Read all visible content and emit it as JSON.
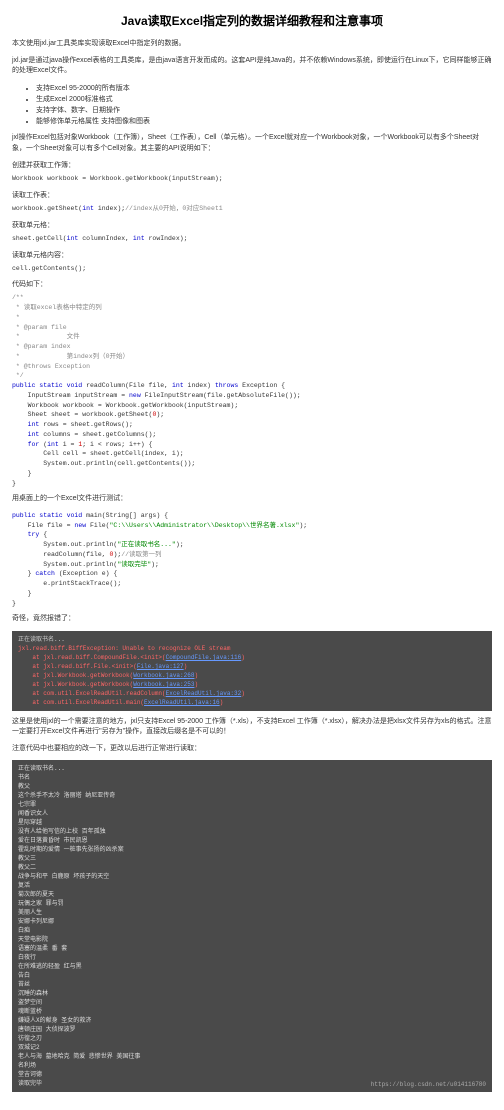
{
  "title": "Java读取Excel指定列的数据详细教程和注意事项",
  "intro1": "本文使用jxl.jar工具类库实现读取Excel中指定列的数据。",
  "intro2": "jxl.jar是通过java操作excel表格的工具类库，是由java语言开发而成的。这套API是纯Java的，并不依赖Windows系统，即使运行在Linux下，它同样能够正确的处理Excel文件。",
  "features": [
    "支持Excel 95-2000的所有版本",
    "生成Excel 2000标准格式",
    "支持字体、数字、日期操作",
    "能够修饰单元格属性 支持图像和图表"
  ],
  "objdesc": "jxl操作Excel包括对象Workbook（工作簿），Sheet（工作表），Cell（单元格）。一个Excel就对应一个Workbook对象，一个Workbook可以有多个Sheet对象，一个Sheet对象可以有多个Cell对象。其主要的API说明如下：",
  "steps": {
    "s1": "创建并获取工作簿：",
    "s1code": "Workbook workbook = Workbook.getWorkbook(inputStream);",
    "s2": "读取工作表：",
    "s2code_a": "workbook.getSheet(",
    "s2code_b": " index);",
    "s2cmt": "//index从0开始，0对应Sheet1",
    "s3": "获取单元格：",
    "s3code_a": "sheet.getCell(",
    "s3code_b": " columnIndex, ",
    "s3code_c": " rowIndex);",
    "s4": "读取单元格内容：",
    "s4code": "cell.getContents();",
    "s5": "代码如下："
  },
  "codedoc": {
    "c1": "/**",
    "c2": " * 读取excel表格中特定的列",
    "c3": " *",
    "c4": " * @param file",
    "c5": " *            文件",
    "c6": " * @param index",
    "c7": " *            第index列（0开始）",
    "c8": " * @throws Exception",
    "c9": " */",
    "l1a": "public static void",
    "l1b": " readColumn(File file, ",
    "l1c": " index) ",
    "l1d": "throws",
    "l1e": " Exception {",
    "l2": "    InputStream inputStream = ",
    "l2b": " FileInputStream(file.getAbsoluteFile());",
    "l3": "    Workbook workbook = Workbook.getWorkbook(inputStream);",
    "l4": "    Sheet sheet = workbook.getSheet(",
    "l4b": ");",
    "l5": "    ",
    "l5b": " rows = sheet.getRows();",
    "l6": "    ",
    "l6b": " columns = sheet.getColumns();",
    "l7": "    ",
    "l7b": " (",
    "l7c": " i = ",
    "l7d": "; i < rows; i++) {",
    "l8": "        Cell cell = sheet.getCell(index, i);",
    "l9": "        System.out.println(cell.getContents());",
    "l10": "    }",
    "l11": "}"
  },
  "mid1": "用桌面上的一个Excel文件进行测试：",
  "main": {
    "l1a": "public static void",
    "l1b": " main(String[] args) {",
    "l2": "    File file = ",
    "l2b": " File(",
    "l2str": "\"C:\\\\Users\\\\Administrator\\\\Desktop\\\\世界名著.xlsx\"",
    "l2c": ");",
    "l3": "    ",
    "l3b": " {",
    "l4": "        System.out.println(",
    "l4str": "\"正在读取书名...\"",
    "l4b": ");",
    "l5": "        readColumn(file, ",
    "l5b": ");",
    "l5cmt": "//读取第一列",
    "l6": "        System.out.println(",
    "l6str": "\"读取完毕\"",
    "l6b": ");",
    "l7": "    } ",
    "l7b": " (Exception e) {",
    "l8": "        e.printStackTrace();",
    "l9": "    }",
    "l10": "}"
  },
  "mid2": "奇怪，竟然报错了：",
  "err": {
    "l1": "正在读取书名...",
    "l2a": "jxl.read.biff.BiffException",
    "l2b": ": Unable to recognize OLE stream",
    "l3a": "    at jxl.read.biff.CompoundFile.<init>(",
    "l3b": "CompoundFile.java:116",
    "l3c": ")",
    "l4a": "    at jxl.read.biff.File.<init>(",
    "l4b": "File.java:127",
    "l4c": ")",
    "l5a": "    at jxl.Workbook.getWorkbook(",
    "l5b": "Workbook.java:268",
    "l5c": ")",
    "l6a": "    at jxl.Workbook.getWorkbook(",
    "l6b": "Workbook.java:253",
    "l6c": ")",
    "l7a": "    at com.util.ExcelReadUtil.readColumn(",
    "l7b": "ExcelReadUtil.java:32",
    "l7c": ")",
    "l8a": "    at com.util.ExcelReadUtil.main(",
    "l8b": "ExcelReadUtil.java:16",
    "l8c": ")"
  },
  "note": "这里是使用jxl的一个需要注意的地方，jxl只支持Excel 95-2000 工作簿（*.xls），不支持Excel 工作簿（*.xlsx），解决办法是把xlsx文件另存为xls的格式。注意一定要打开Excel文件再进行\"另存为\"操作，直接改后缀名是不可以的！",
  "note2": "注意代码中也要相应的改一下，更改以后进行正常进行读取：",
  "output": {
    "lines": [
      "正在读取书名...",
      "书名",
      "教父",
      "这个杀手不太冷 洛丽塔 纳尼亚传奇",
      "七宗罪",
      "闻香识女人",
      "星际穿越",
      "没有人给他写信的上校 百年孤独",
      "爱在日落黄昏时 市民凯恩",
      "霍乱时期的爱情 一桩事先张扬的凶杀案",
      "教父三",
      "教父二",
      "战争与和平 白鹿原 坏孩子的天空",
      "复活",
      "菊次郎的夏天",
      "玩偶之家 罪与罚",
      "美丽人生",
      "安娜卡列尼娜",
      "白痴",
      "天堂电影院",
      "语塞的温柔 番 套",
      "白夜行",
      "在所难逃的轻盈 红与黑",
      "告白",
      "苔丝",
      "沉睡的森林",
      "盗梦空间",
      "魂断蓝桥",
      "嫌疑人X的献身 圣女的救济",
      "唐顿庄园 大侦探波罗",
      "彷徨之刃",
      "双城记2",
      "老人与海 墓地哈克 简爱 悲惨世界 美国往事",
      "名利场",
      "堂吉诃德",
      "读取完毕"
    ],
    "watermark": "https://blog.csdn.net/u014116780"
  }
}
